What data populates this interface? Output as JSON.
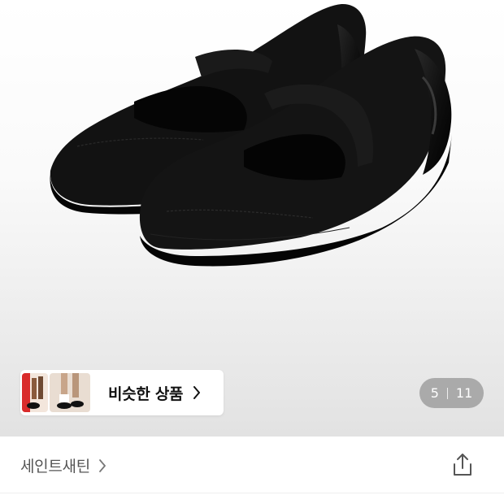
{
  "product_image": {
    "alt": "",
    "icon": "product-photo-black-mary-jane-shoes"
  },
  "gallery": {
    "current": "5",
    "total": "11"
  },
  "similar_products": {
    "label": "비슷한 상품",
    "icon": "chevron-right-icon"
  },
  "brand": {
    "name": "세인트새틴",
    "icon": "chevron-right-icon"
  },
  "share": {
    "icon": "share-icon"
  },
  "colors": {
    "counter_bg": "#8a8a8a",
    "text_primary": "#111111",
    "text_secondary": "#555555"
  }
}
